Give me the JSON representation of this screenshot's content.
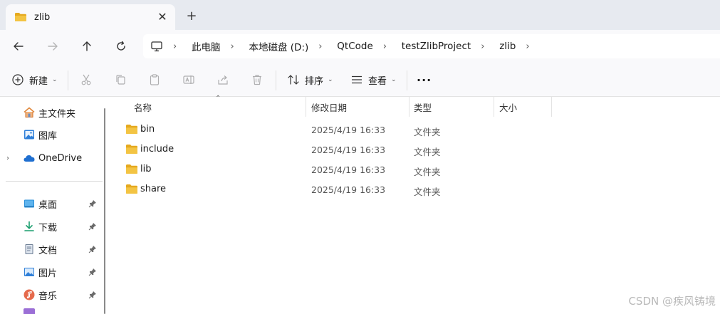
{
  "tab": {
    "title": "zlib",
    "close": "✕",
    "new_tab": "+"
  },
  "breadcrumb": {
    "items": [
      "此电脑",
      "本地磁盘 (D:)",
      "QtCode",
      "testZlibProject",
      "zlib"
    ],
    "separator": "›"
  },
  "toolbar": {
    "new_label": "新建",
    "sort_label": "排序",
    "view_label": "查看",
    "more_label": "···",
    "dropdown_glyph": "⌄"
  },
  "sidebar": {
    "expander": "›",
    "items": [
      {
        "label": "主文件夹",
        "icon": "home-icon"
      },
      {
        "label": "图库",
        "icon": "gallery-icon"
      },
      {
        "label": "OneDrive",
        "icon": "cloud-icon"
      },
      {
        "label": "桌面",
        "icon": "desktop-icon",
        "pinned": true
      },
      {
        "label": "下载",
        "icon": "download-icon",
        "pinned": true
      },
      {
        "label": "文档",
        "icon": "document-icon",
        "pinned": true
      },
      {
        "label": "图片",
        "icon": "pictures-icon",
        "pinned": true
      },
      {
        "label": "音乐",
        "icon": "music-icon",
        "pinned": true
      }
    ]
  },
  "columns": {
    "name": "名称",
    "modified": "修改日期",
    "type": "类型",
    "size": "大小",
    "sort_indicator": "⌃"
  },
  "files": [
    {
      "name": "bin",
      "modified": "2025/4/19 16:33",
      "type": "文件夹"
    },
    {
      "name": "include",
      "modified": "2025/4/19 16:33",
      "type": "文件夹"
    },
    {
      "name": "lib",
      "modified": "2025/4/19 16:33",
      "type": "文件夹"
    },
    {
      "name": "share",
      "modified": "2025/4/19 16:33",
      "type": "文件夹"
    }
  ],
  "watermark": "CSDN @疾风铸境",
  "colors": {
    "folder": "#f3c443",
    "folder_dark": "#e5a91f",
    "accent": "#0a64d6",
    "onedrive": "#1f6fd0"
  }
}
